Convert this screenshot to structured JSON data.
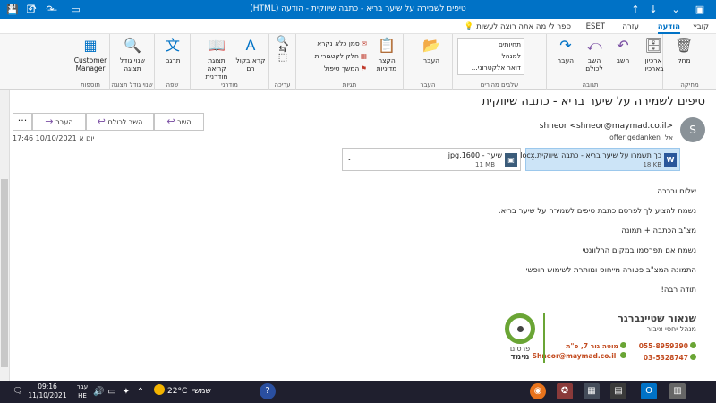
{
  "window": {
    "title": "טיפים לשמירה על שיער בריא - כתבה שיווקית  -  הודעה (HTML)"
  },
  "tabs": [
    "קובץ",
    "הודעה",
    "עזרה",
    "ESET",
    "ספר לי מה אתה רוצה לעשות"
  ],
  "ribbon": {
    "delete_group": {
      "label": "מחיקה",
      "delete": "מחק",
      "archive": "ארכיון בארכיון"
    },
    "respond_group": {
      "label": "תגובה",
      "reply": "השב",
      "reply_all": "השב לכולם",
      "forward": "העבר"
    },
    "quick_steps": {
      "label": "שלבים מהירים",
      "items": [
        "תחיותים",
        "למנהל",
        "דואר אלקטרוני..."
      ]
    },
    "move_group": {
      "label": "העבר",
      "move": "העבר"
    },
    "tags_group": {
      "label": "תגיות",
      "assign_policy": "הקצה מדיניות",
      "mark_unread": "סמן כלא נקרא",
      "categorize": "חלק לקטגוריות",
      "follow_up": "המשך טיפול"
    },
    "editing_group": {
      "label": "עריכה"
    },
    "speech_group": {
      "label": "מודרני",
      "read_aloud": "קרא בקול רם",
      "immersive": "תצוגת קריאה מודרנית"
    },
    "language_group": {
      "label": "שפה",
      "translate": "תרגם"
    },
    "zoom_group": {
      "label": "שנוי גודל תצוגה",
      "zoom": "שנוי גודל תצוגה"
    },
    "addins_group": {
      "label": "תוספות",
      "customer_manager": "Customer Manager"
    }
  },
  "message": {
    "subject": "טיפים לשמירה על שיער בריא - כתבה שיווקית",
    "actions": {
      "reply": "השב",
      "reply_all": "השב לכולם",
      "forward": "העבר"
    },
    "date": "יום א 10/10/2021 17:46",
    "avatar_letter": "S",
    "sender": "shneor <shneor@maymad.co.il>",
    "to_label": "אל",
    "to": "offer gedanken",
    "attachments": [
      {
        "name": "כך תשמרו על שיער בריא - כתבה שיווקית.docx",
        "size": "18 KB"
      },
      {
        "name": "שיער - 1600.jpg",
        "size": "11 MB"
      }
    ],
    "body": [
      "שלום וברכה",
      "נשמח להציע לך לפרסם כתבת טיפים לשמירה על שיער בריא.",
      "מצ\"ב הכתבה + תמונה",
      "נשמח אם תפרסמו במקום הרלוונטי",
      "התמונה המצ\"ב פטורה מייחוס ומותרת לשימוש חופשי",
      "תודה רבה!"
    ],
    "signature": {
      "name": "שנאור שטיינברגר",
      "title": "מנהל יחסי ציבור",
      "phone1": "055-8959390",
      "phone2": "03-5328747",
      "address": "מוטה גור 7, פ\"ת",
      "email": "Shneor@maymad.co.il",
      "logo_line1": "פרסום",
      "logo_line2": "מימד"
    }
  },
  "taskbar": {
    "time": "09:16",
    "date": "11/10/2021",
    "lang1": "עבר",
    "lang2": "HE",
    "temperature": "22°C",
    "weather": "שמשי"
  },
  "colors": {
    "accent": "#0072c6",
    "taskbar": "#1f1f2e",
    "sig_green": "#6aa535",
    "sig_orange": "#c24a1e"
  }
}
